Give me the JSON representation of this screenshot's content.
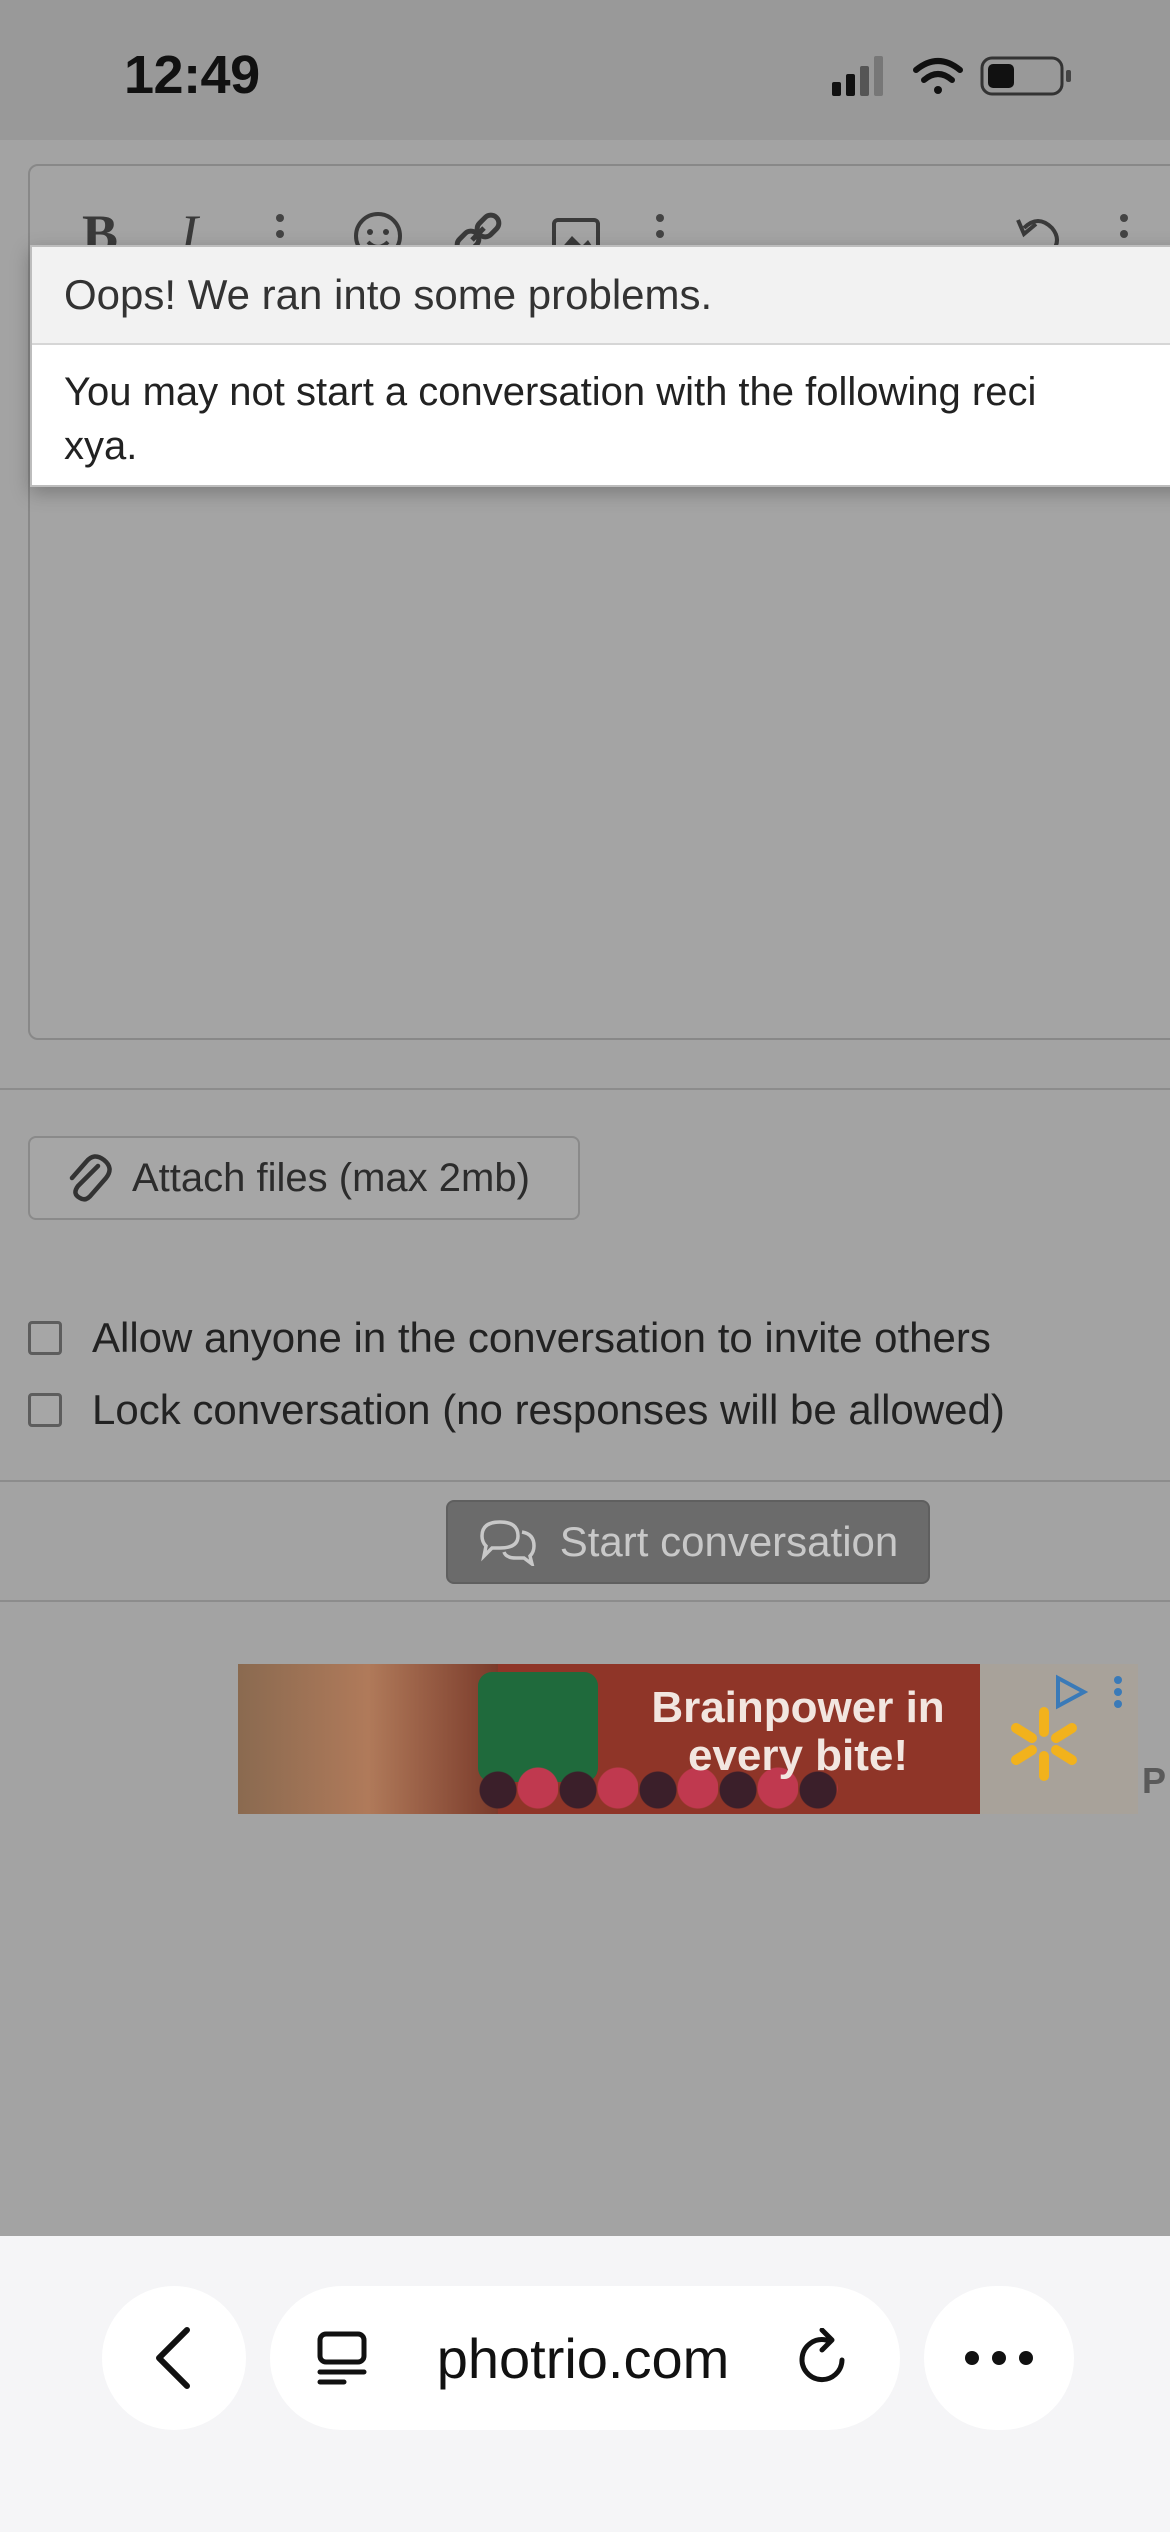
{
  "status_bar": {
    "time": "12:49"
  },
  "editor": {
    "toolbar": {
      "bold_label": "B",
      "italic_label": "I"
    }
  },
  "error_dialog": {
    "title": "Oops! We ran into some problems.",
    "message": "You may not start a conversation with the following reci\nxya."
  },
  "attach": {
    "label": "Attach files (max 2mb)"
  },
  "options": [
    {
      "label": "Allow anyone in the conversation to invite others",
      "checked": false
    },
    {
      "label": "Lock conversation (no responses will be allowed)",
      "checked": false
    }
  ],
  "submit": {
    "label": "Start conversation"
  },
  "ad": {
    "headline": "Brainpower in every bite!",
    "trailing_letter": "P"
  },
  "browser": {
    "url": "photrio.com"
  },
  "colors": {
    "overlay": "#9e9e9e",
    "button_dark": "#6b6b6b",
    "ad_red": "#8f3528"
  }
}
